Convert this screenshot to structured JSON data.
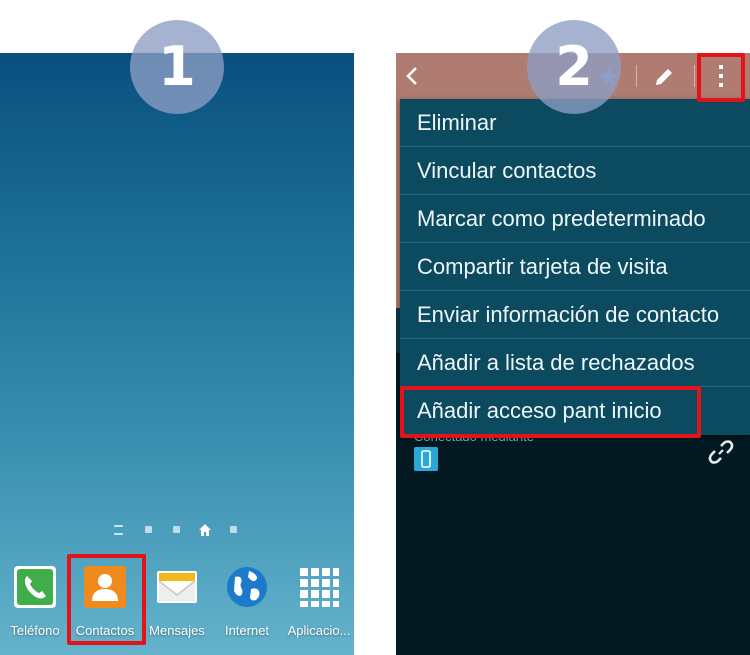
{
  "badges": {
    "step1": "1",
    "step2": "2"
  },
  "home_screen": {
    "dock": [
      {
        "label": "Teléfono",
        "icon": "phone-icon"
      },
      {
        "label": "Contactos",
        "icon": "contacts-icon"
      },
      {
        "label": "Mensajes",
        "icon": "messages-icon"
      },
      {
        "label": "Internet",
        "icon": "internet-globe-icon"
      },
      {
        "label": "Aplicacio...",
        "icon": "apps-grid-icon"
      }
    ]
  },
  "contact_screen": {
    "menu": [
      "Eliminar",
      "Vincular contactos",
      "Marcar como predeterminado",
      "Compartir tarjeta de visita",
      "Enviar información de contacto",
      "Añadir a lista de rechazados",
      "Añadir acceso pant inicio"
    ],
    "connected_via": "Conectado mediante",
    "icons": [
      "back-arrow-icon",
      "star-icon",
      "edit-pencil-icon",
      "overflow-menu-icon",
      "phone-device-icon",
      "link-icon"
    ]
  },
  "colors": {
    "highlight": "#e3131a",
    "menu_bg": "#0b4a5f",
    "header_bg": "#b07c72"
  }
}
